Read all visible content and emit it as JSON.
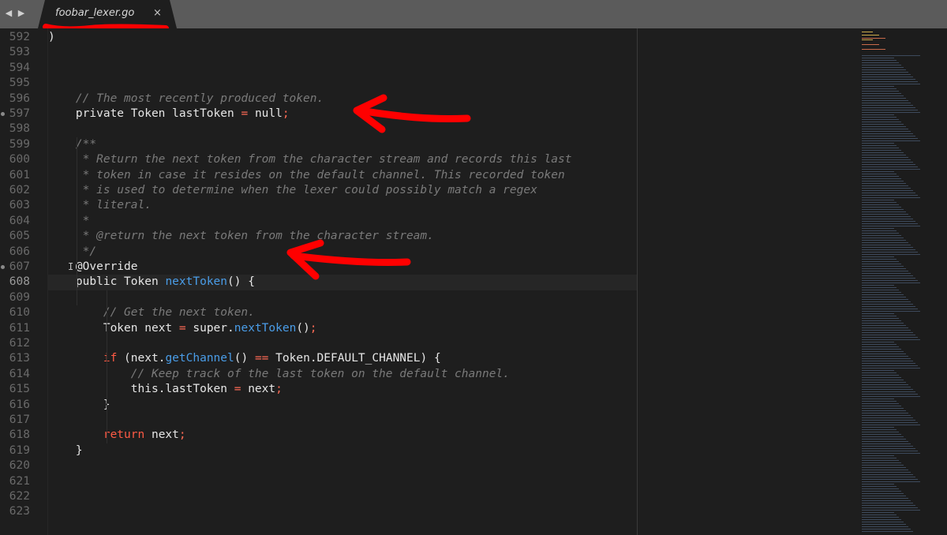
{
  "window": {
    "nav_back_icon": "triangle-left-icon",
    "nav_forward_icon": "triangle-right-icon"
  },
  "tab": {
    "title": "foobar_lexer.go",
    "close_glyph": "×"
  },
  "annotations": {
    "redaction_color": "#ff0000",
    "arrow_color": "#ff0000"
  },
  "colors": {
    "background": "#1e1e1e",
    "tab_bar": "#5b5b5b",
    "keyword": "#ff5b45",
    "function": "#4a9de8",
    "comment": "#7a7a7a",
    "text": "#e6e6e6"
  },
  "editor": {
    "current_line": 608,
    "modified_marker_lines": [
      597,
      607
    ],
    "lines": [
      {
        "n": "592",
        "text": ")"
      },
      {
        "n": "593",
        "text": ""
      },
      {
        "n": "594",
        "text": ""
      },
      {
        "n": "595",
        "text": ""
      },
      {
        "n": "596",
        "text": "    // The most recently produced token."
      },
      {
        "n": "597",
        "text": "    private Token lastToken = null;"
      },
      {
        "n": "598",
        "text": ""
      },
      {
        "n": "599",
        "text": "    /**"
      },
      {
        "n": "600",
        "text": "     * Return the next token from the character stream and records this last"
      },
      {
        "n": "601",
        "text": "     * token in case it resides on the default channel. This recorded token"
      },
      {
        "n": "602",
        "text": "     * is used to determine when the lexer could possibly match a regex"
      },
      {
        "n": "603",
        "text": "     * literal."
      },
      {
        "n": "604",
        "text": "     *"
      },
      {
        "n": "605",
        "text": "     * @return the next token from the character stream."
      },
      {
        "n": "606",
        "text": "     */"
      },
      {
        "n": "607",
        "text": "    @Override"
      },
      {
        "n": "608",
        "text": "    public Token nextToken() {"
      },
      {
        "n": "609",
        "text": ""
      },
      {
        "n": "610",
        "text": "        // Get the next token."
      },
      {
        "n": "611",
        "text": "        Token next = super.nextToken();"
      },
      {
        "n": "612",
        "text": ""
      },
      {
        "n": "613",
        "text": "        if (next.getChannel() == Token.DEFAULT_CHANNEL) {"
      },
      {
        "n": "614",
        "text": "            // Keep track of the last token on the default channel."
      },
      {
        "n": "615",
        "text": "            this.lastToken = next;"
      },
      {
        "n": "616",
        "text": "        }"
      },
      {
        "n": "617",
        "text": ""
      },
      {
        "n": "618",
        "text": "        return next;"
      },
      {
        "n": "619",
        "text": "    }"
      },
      {
        "n": "620",
        "text": ""
      },
      {
        "n": "621",
        "text": ""
      },
      {
        "n": "622",
        "text": ""
      },
      {
        "n": "623",
        "text": ""
      }
    ]
  }
}
